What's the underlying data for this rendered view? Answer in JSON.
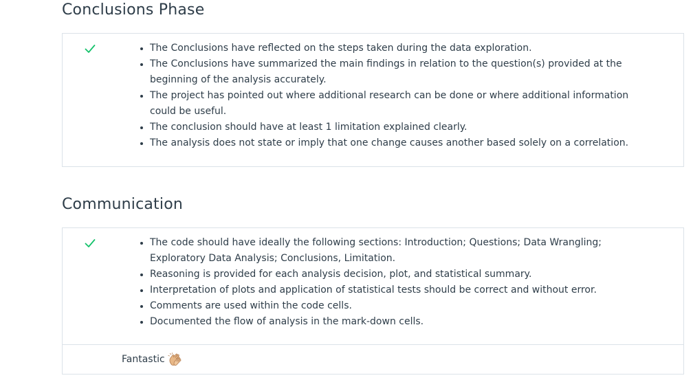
{
  "sections": [
    {
      "title": "Conclusions Phase",
      "status_icon": "check-icon",
      "criteria": [
        "The Conclusions have reflected on the steps taken during the data exploration.",
        "The Conclusions have summarized the main findings in relation to the question(s) provided at the beginning of the analysis accurately.",
        "The project has pointed out where additional research can be done or where additional information could be useful.",
        "The conclusion should have at least 1 limitation explained clearly.",
        "The analysis does not state or imply that one change causes another based solely on a correlation."
      ]
    },
    {
      "title": "Communication",
      "status_icon": "check-icon",
      "criteria": [
        "The code should have ideally the following sections: Introduction; Questions; Data Wrangling; Exploratory Data Analysis; Conclusions, Limitation.",
        "Reasoning is provided for each analysis decision, plot, and statistical summary.",
        "Interpretation of plots and application of statistical tests should be correct and without error.",
        "Comments are used within the code cells.",
        "Documented the flow of analysis in the mark-down cells."
      ],
      "reviewer_comment": {
        "text": "Fantastic",
        "icon": "clapping-hands-icon"
      }
    }
  ],
  "colors": {
    "check": "#02b3e4",
    "check_green": "#15c26b",
    "border": "#dbe2e8",
    "text": "#2e3d49"
  }
}
